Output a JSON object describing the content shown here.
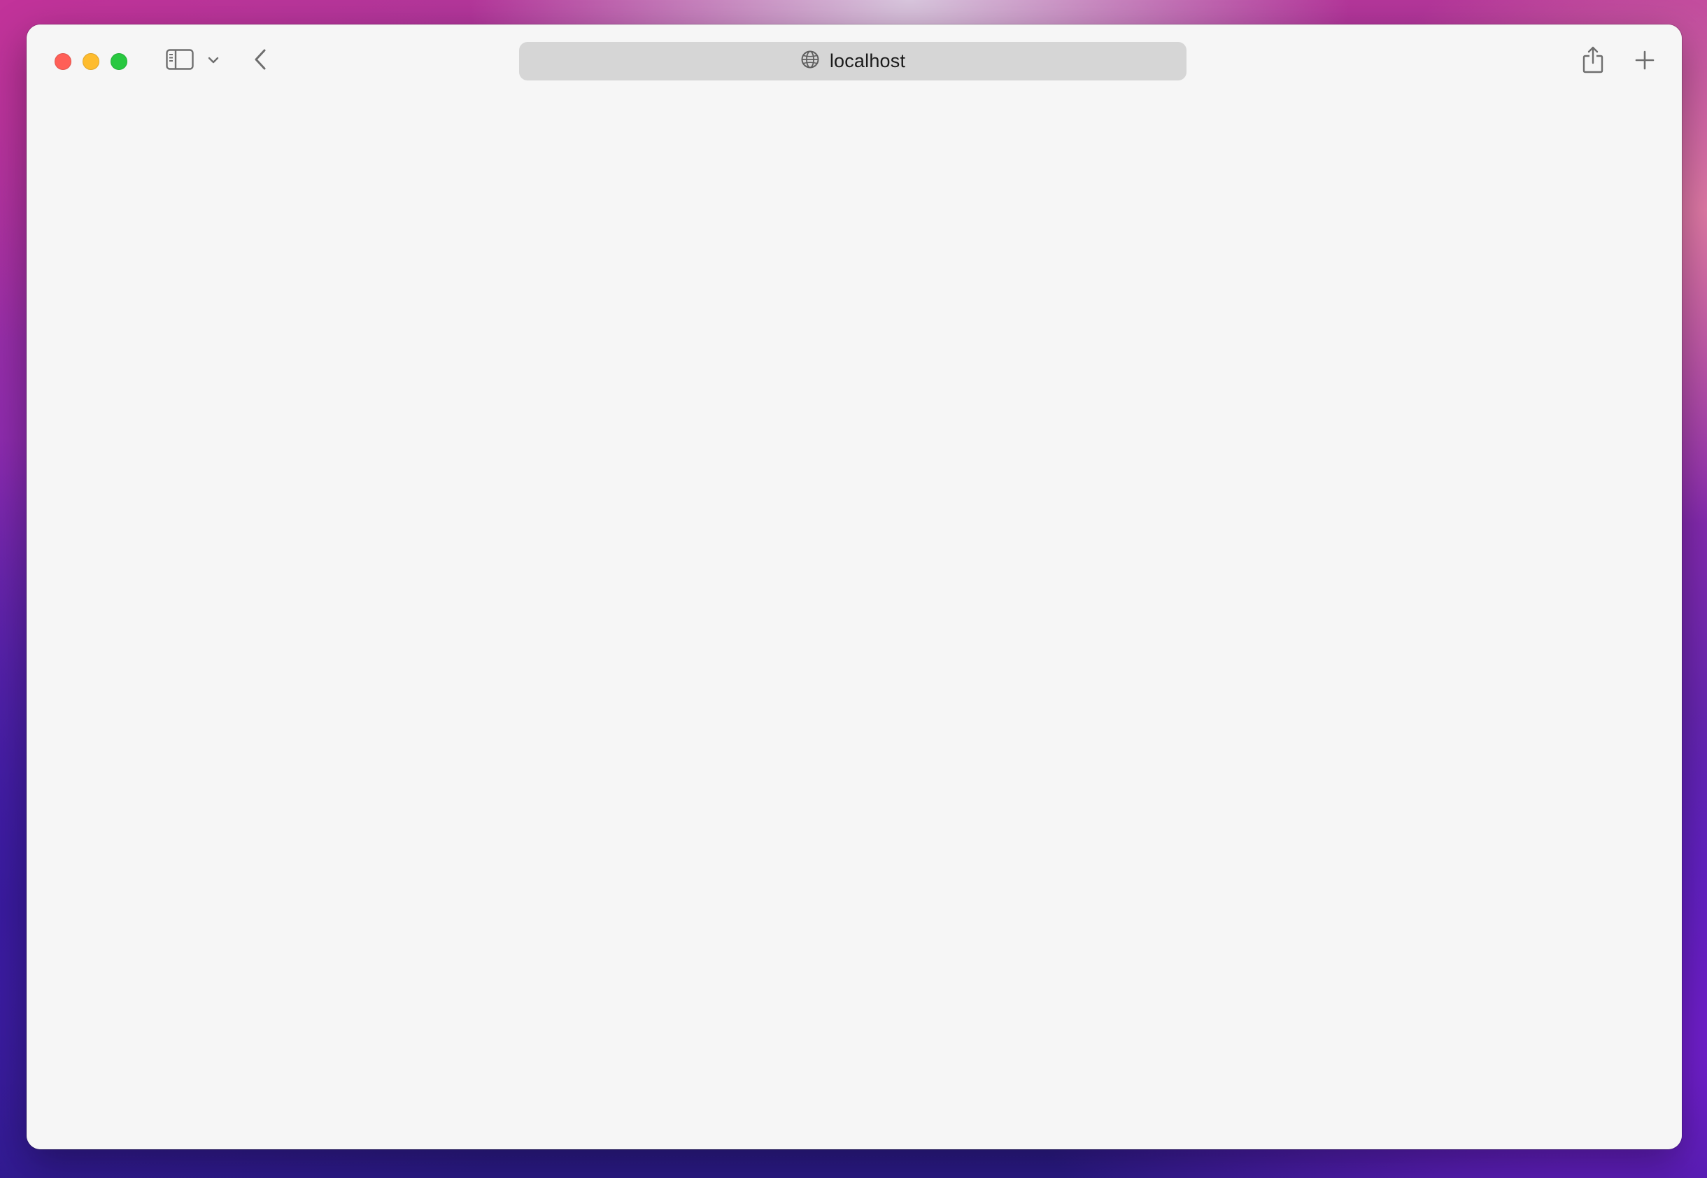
{
  "window": {
    "traffic_lights": {
      "close_color": "#ff5f57",
      "minimize_color": "#febc2e",
      "zoom_color": "#28c840"
    }
  },
  "toolbar": {
    "icons": {
      "sidebar": "sidebar-icon",
      "tab_group_menu": "chevron-down-icon",
      "back": "chevron-left-icon",
      "site": "globe-icon",
      "share": "share-icon",
      "new_tab": "plus-icon"
    }
  },
  "address_bar": {
    "url": "localhost"
  },
  "colors": {
    "window_background": "#f6f6f6",
    "address_bar_background": "#d6d6d6",
    "icon_color": "#6e6e6e"
  }
}
